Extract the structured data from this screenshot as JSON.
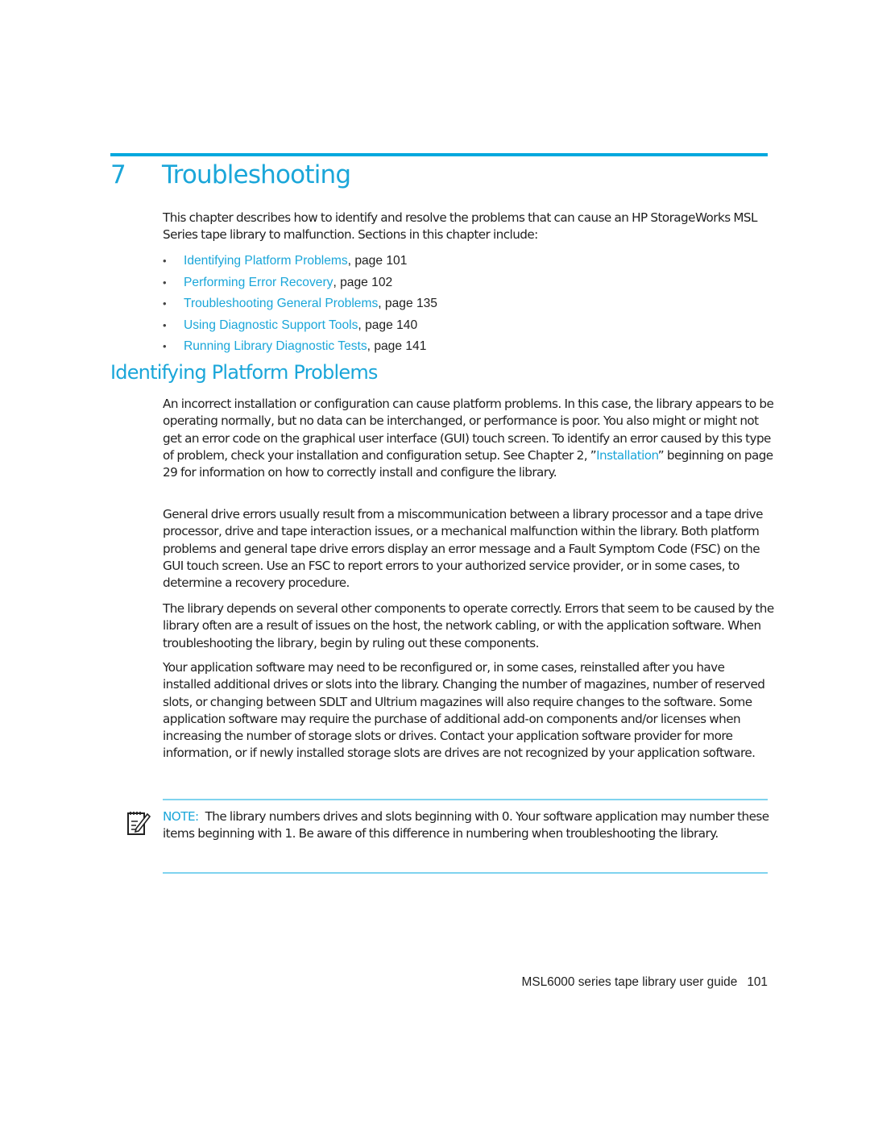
{
  "chapter": {
    "number": "7",
    "title": "Troubleshooting",
    "intro": "This chapter describes how to identify and resolve the problems that can cause an HP StorageWorks MSL Series tape library to malfunction. Sections in this chapter include:",
    "toc": [
      {
        "link": "Identifying Platform Problems",
        "suffix": ", page 101"
      },
      {
        "link": "Performing Error Recovery",
        "suffix": ", page 102"
      },
      {
        "link": "Troubleshooting General Problems",
        "suffix": ", page 135"
      },
      {
        "link": "Using Diagnostic Support Tools",
        "suffix": ", page 140"
      },
      {
        "link": "Running Library Diagnostic Tests",
        "suffix": ", page 141"
      }
    ]
  },
  "section": {
    "heading": "Identifying Platform Problems",
    "p1_before": "An incorrect installation or configuration can cause platform problems. In this case, the library appears to be operating normally, but no data can be interchanged, or performance is poor. You also might or might not get an error code on the graphical user interface (GUI) touch screen. To identify an error caused by this type of problem, check your installation and configuration setup. See Chapter 2, ”",
    "p1_link": "Installation",
    "p1_after": "” beginning on page 29 for information on how to correctly install and configure the library.",
    "p2": "General drive errors usually result from a miscommunication between a library processor and a tape drive processor, drive and tape interaction issues, or a mechanical malfunction within the library. Both platform problems and general tape drive errors display an error message and a Fault Symptom Code (FSC) on the GUI touch screen. Use an FSC to report errors to your authorized service provider, or in some cases, to determine a recovery procedure.",
    "p3": "The library depends on several other components to operate correctly. Errors that seem to be caused by the library often are a result of issues on the host, the network cabling, or with the application software. When troubleshooting the library, begin by ruling out these components.",
    "p4": "Your application software may need to be reconfigured or, in some cases, reinstalled after you have installed additional drives or slots into the library. Changing the number of magazines, number of reserved slots, or changing between SDLT and Ultrium magazines will also require changes to the software. Some application software may require the purchase of additional add-on components and/or licenses when increasing the number of storage slots or drives. Contact your application software provider for more information, or if newly installed storage slots are drives are not recognized by your application software."
  },
  "note": {
    "icon": "note-pencil-icon",
    "label": "NOTE:",
    "text": "The library numbers drives and slots beginning with 0. Your software application may number these items beginning with 1. Be aware of this difference in numbering when troubleshooting the library."
  },
  "footer": {
    "guide_title": "MSL6000 series tape library user guide",
    "page_number": "101"
  },
  "colors": {
    "accent": "#1aa6d9",
    "rule": "#00a8de",
    "note_rule": "#7fd3ef",
    "text": "#1f1f1f"
  }
}
